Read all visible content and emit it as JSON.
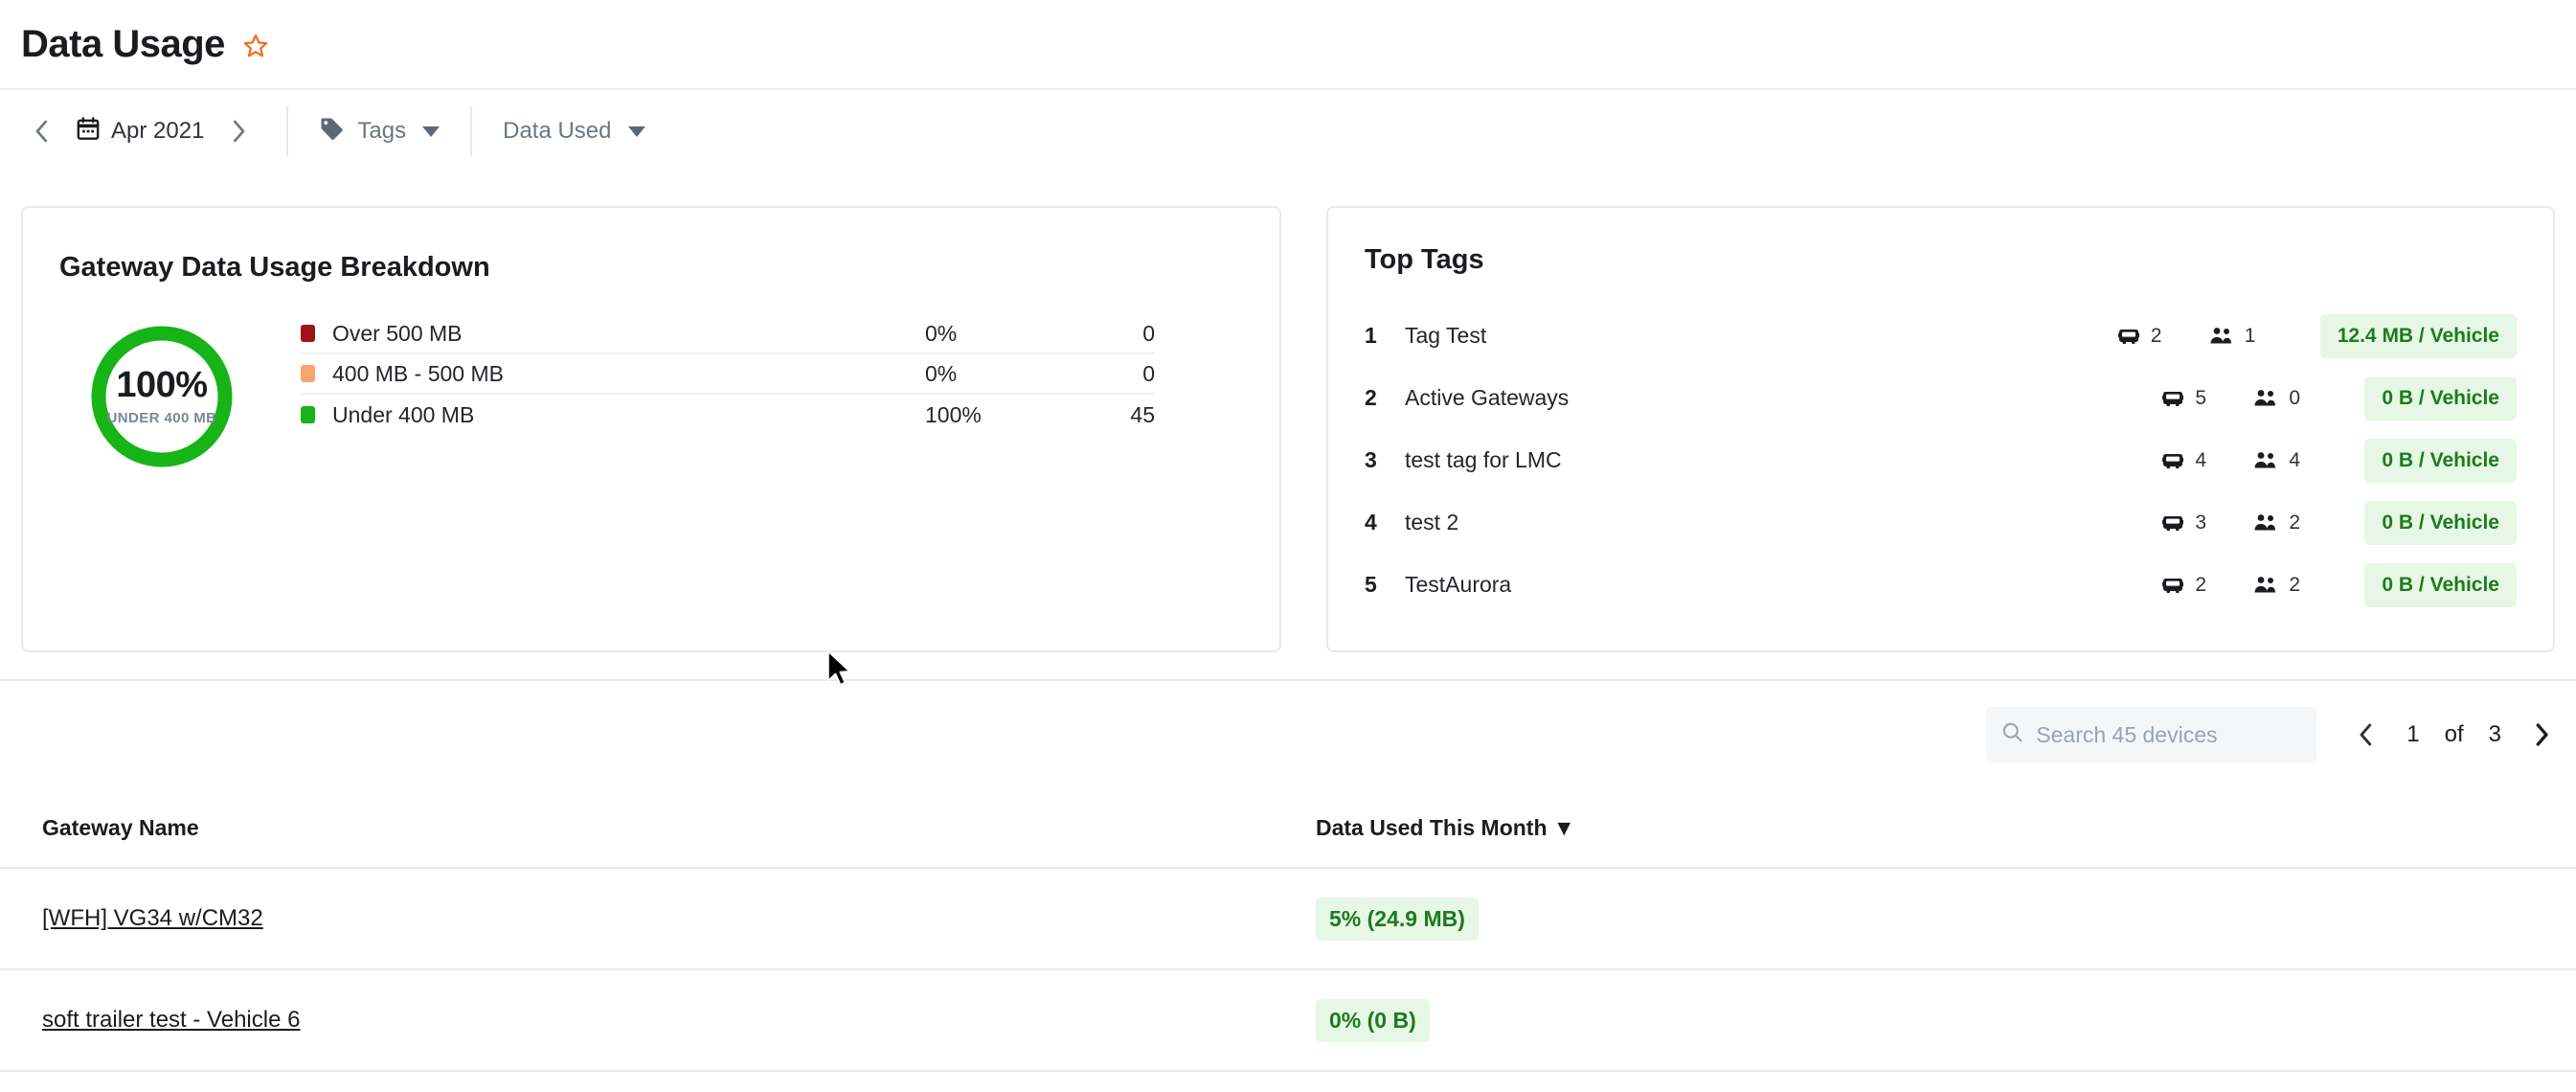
{
  "header": {
    "title": "Data Usage",
    "favorite_icon": "star-icon",
    "favorite_color": "#ef6c21"
  },
  "toolbar": {
    "prev_month_icon": "chevron-left-icon",
    "next_month_icon": "chevron-right-icon",
    "calendar_icon": "calendar-icon",
    "date_label": "Apr 2021",
    "tag_icon": "tag-icon",
    "tags_label": "Tags",
    "data_used_label": "Data Used"
  },
  "breakdown": {
    "title": "Gateway Data Usage Breakdown",
    "donut": {
      "percent_label": "100%",
      "sub_label": "UNDER 400 MB"
    },
    "legend": [
      {
        "color": "#a11017",
        "label": "Over 500 MB",
        "percent": "0%",
        "count": "0"
      },
      {
        "color": "#f6a570",
        "label": "400 MB - 500 MB",
        "percent": "0%",
        "count": "0"
      },
      {
        "color": "#16b416",
        "label": "Under 400 MB",
        "percent": "100%",
        "count": "45"
      }
    ]
  },
  "top_tags": {
    "title": "Top Tags",
    "vehicle_icon": "vehicle-icon",
    "people_icon": "people-icon",
    "rows": [
      {
        "rank": "1",
        "name": "Tag Test",
        "vehicles": "2",
        "people": "1",
        "badge": "12.4 MB / Vehicle"
      },
      {
        "rank": "2",
        "name": "Active Gateways",
        "vehicles": "5",
        "people": "0",
        "badge": "0 B / Vehicle"
      },
      {
        "rank": "3",
        "name": "test tag for LMC",
        "vehicles": "4",
        "people": "4",
        "badge": "0 B / Vehicle"
      },
      {
        "rank": "4",
        "name": "test 2",
        "vehicles": "3",
        "people": "2",
        "badge": "0 B / Vehicle"
      },
      {
        "rank": "5",
        "name": "TestAurora",
        "vehicles": "2",
        "people": "2",
        "badge": "0 B / Vehicle"
      }
    ]
  },
  "search": {
    "icon": "search-icon",
    "placeholder": "Search 45 devices",
    "value": ""
  },
  "pagination": {
    "prev_icon": "chevron-left-icon",
    "next_icon": "chevron-right-icon",
    "current_page": "1",
    "of_label": "of",
    "total_pages": "3"
  },
  "table": {
    "columns": {
      "gateway_name": "Gateway Name",
      "data_used": "Data Used This Month",
      "sort_indicator": "▼"
    },
    "rows": [
      {
        "gateway_name": "[WFH] VG34 w/CM32",
        "data_used": "5% (24.9 MB)"
      },
      {
        "gateway_name": "soft trailer test - Vehicle 6",
        "data_used": "0% (0 B)"
      }
    ]
  },
  "chart_data": {
    "type": "pie",
    "title": "Gateway Data Usage Breakdown",
    "categories": [
      "Over 500 MB",
      "400 MB - 500 MB",
      "Under 400 MB"
    ],
    "values": [
      0,
      0,
      45
    ],
    "percentages": [
      0,
      0,
      100
    ],
    "colors": [
      "#a11017",
      "#f6a570",
      "#16b416"
    ],
    "center_value": "100%",
    "center_label": "UNDER 400 MB",
    "legend_position": "right",
    "total": 45
  }
}
